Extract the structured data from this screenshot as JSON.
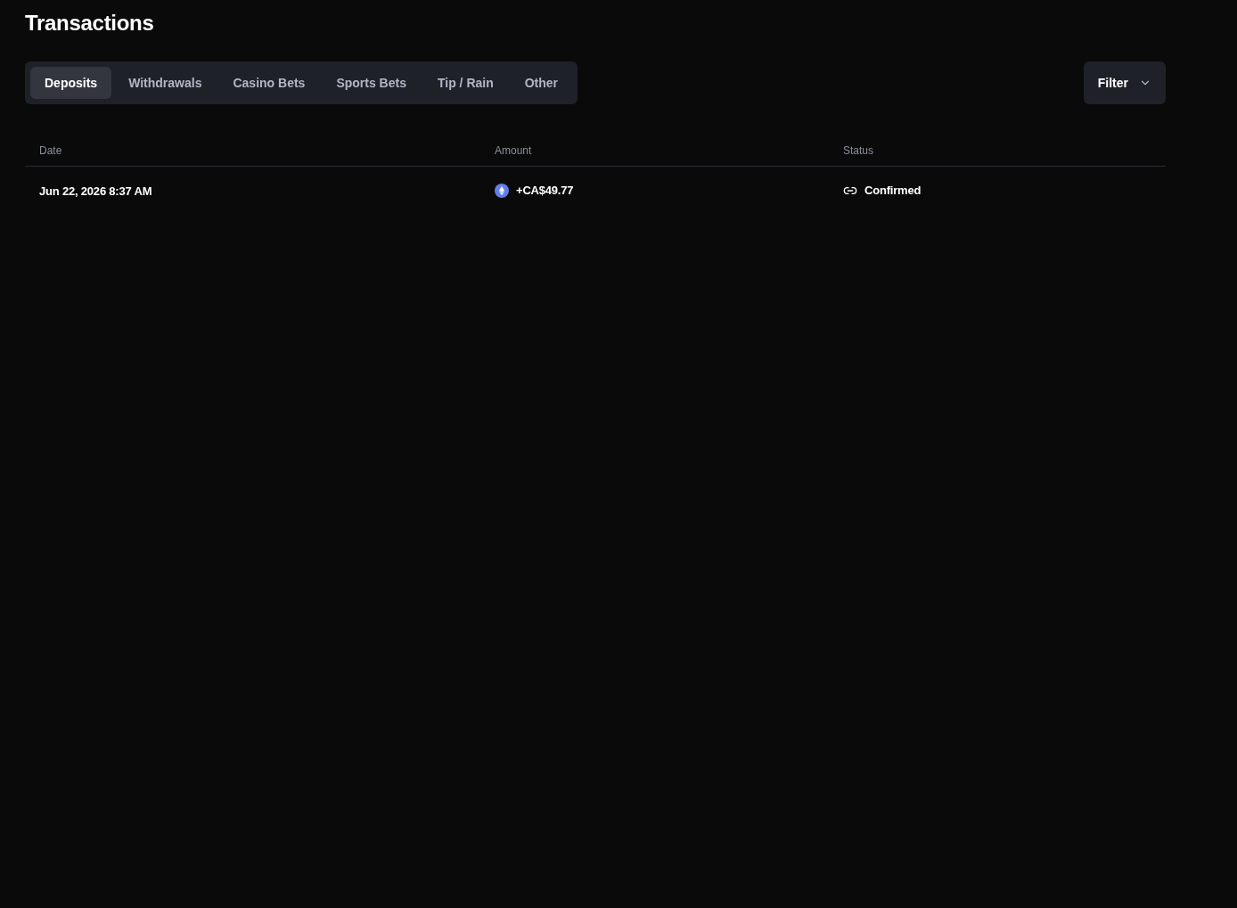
{
  "page": {
    "title": "Transactions"
  },
  "tabs": [
    {
      "label": "Deposits",
      "selected": true
    },
    {
      "label": "Withdrawals",
      "selected": false
    },
    {
      "label": "Casino Bets",
      "selected": false
    },
    {
      "label": "Sports Bets",
      "selected": false
    },
    {
      "label": "Tip / Rain",
      "selected": false
    },
    {
      "label": "Other",
      "selected": false
    }
  ],
  "filter_button": {
    "label": "Filter"
  },
  "table": {
    "columns": [
      "Date",
      "Amount",
      "Status"
    ],
    "rows": [
      {
        "date": "Jun 22, 2026 8:37 AM",
        "amount": "+CA$49.77",
        "status": "Confirmed"
      }
    ]
  }
}
